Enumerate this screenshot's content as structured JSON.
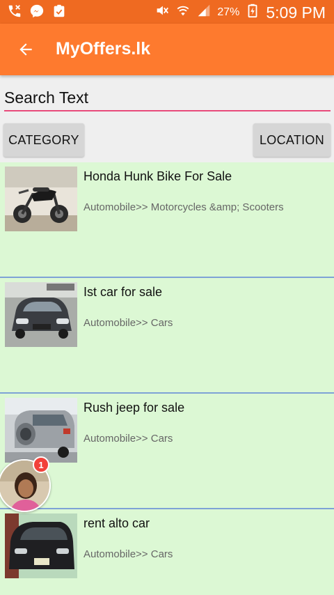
{
  "status_bar": {
    "left_icons": [
      "missed-call-icon",
      "messenger-icon",
      "clipboard-check-icon"
    ],
    "right_icons": [
      "mute-icon",
      "wifi-icon",
      "signal-icon",
      "battery-charging-icon"
    ],
    "battery": "27%",
    "time": "5:09 PM"
  },
  "app_bar": {
    "title": "MyOffers.lk",
    "back_icon": "back-arrow-icon",
    "background": "#fe7a2e"
  },
  "search": {
    "placeholder": "Search Text",
    "value": ""
  },
  "filters": {
    "category_label": "CATEGORY",
    "location_label": "LOCATION"
  },
  "listings": [
    {
      "title": "Honda Hunk Bike For Sale",
      "category": "Automobile>> Motorcycles &amp; Scooters"
    },
    {
      "title": "Ist car for sale",
      "category": "Automobile>> Cars"
    },
    {
      "title": "Rush jeep for sale",
      "category": "Automobile>> Cars"
    },
    {
      "title": "rent alto car",
      "category": "Automobile>> Cars"
    }
  ],
  "chat_head": {
    "badge": "1"
  },
  "colors": {
    "status_bar": "#ef6a21",
    "accent_underline": "#e8497a",
    "list_background": "#dcf8d4",
    "divider": "#7ea2d6"
  }
}
